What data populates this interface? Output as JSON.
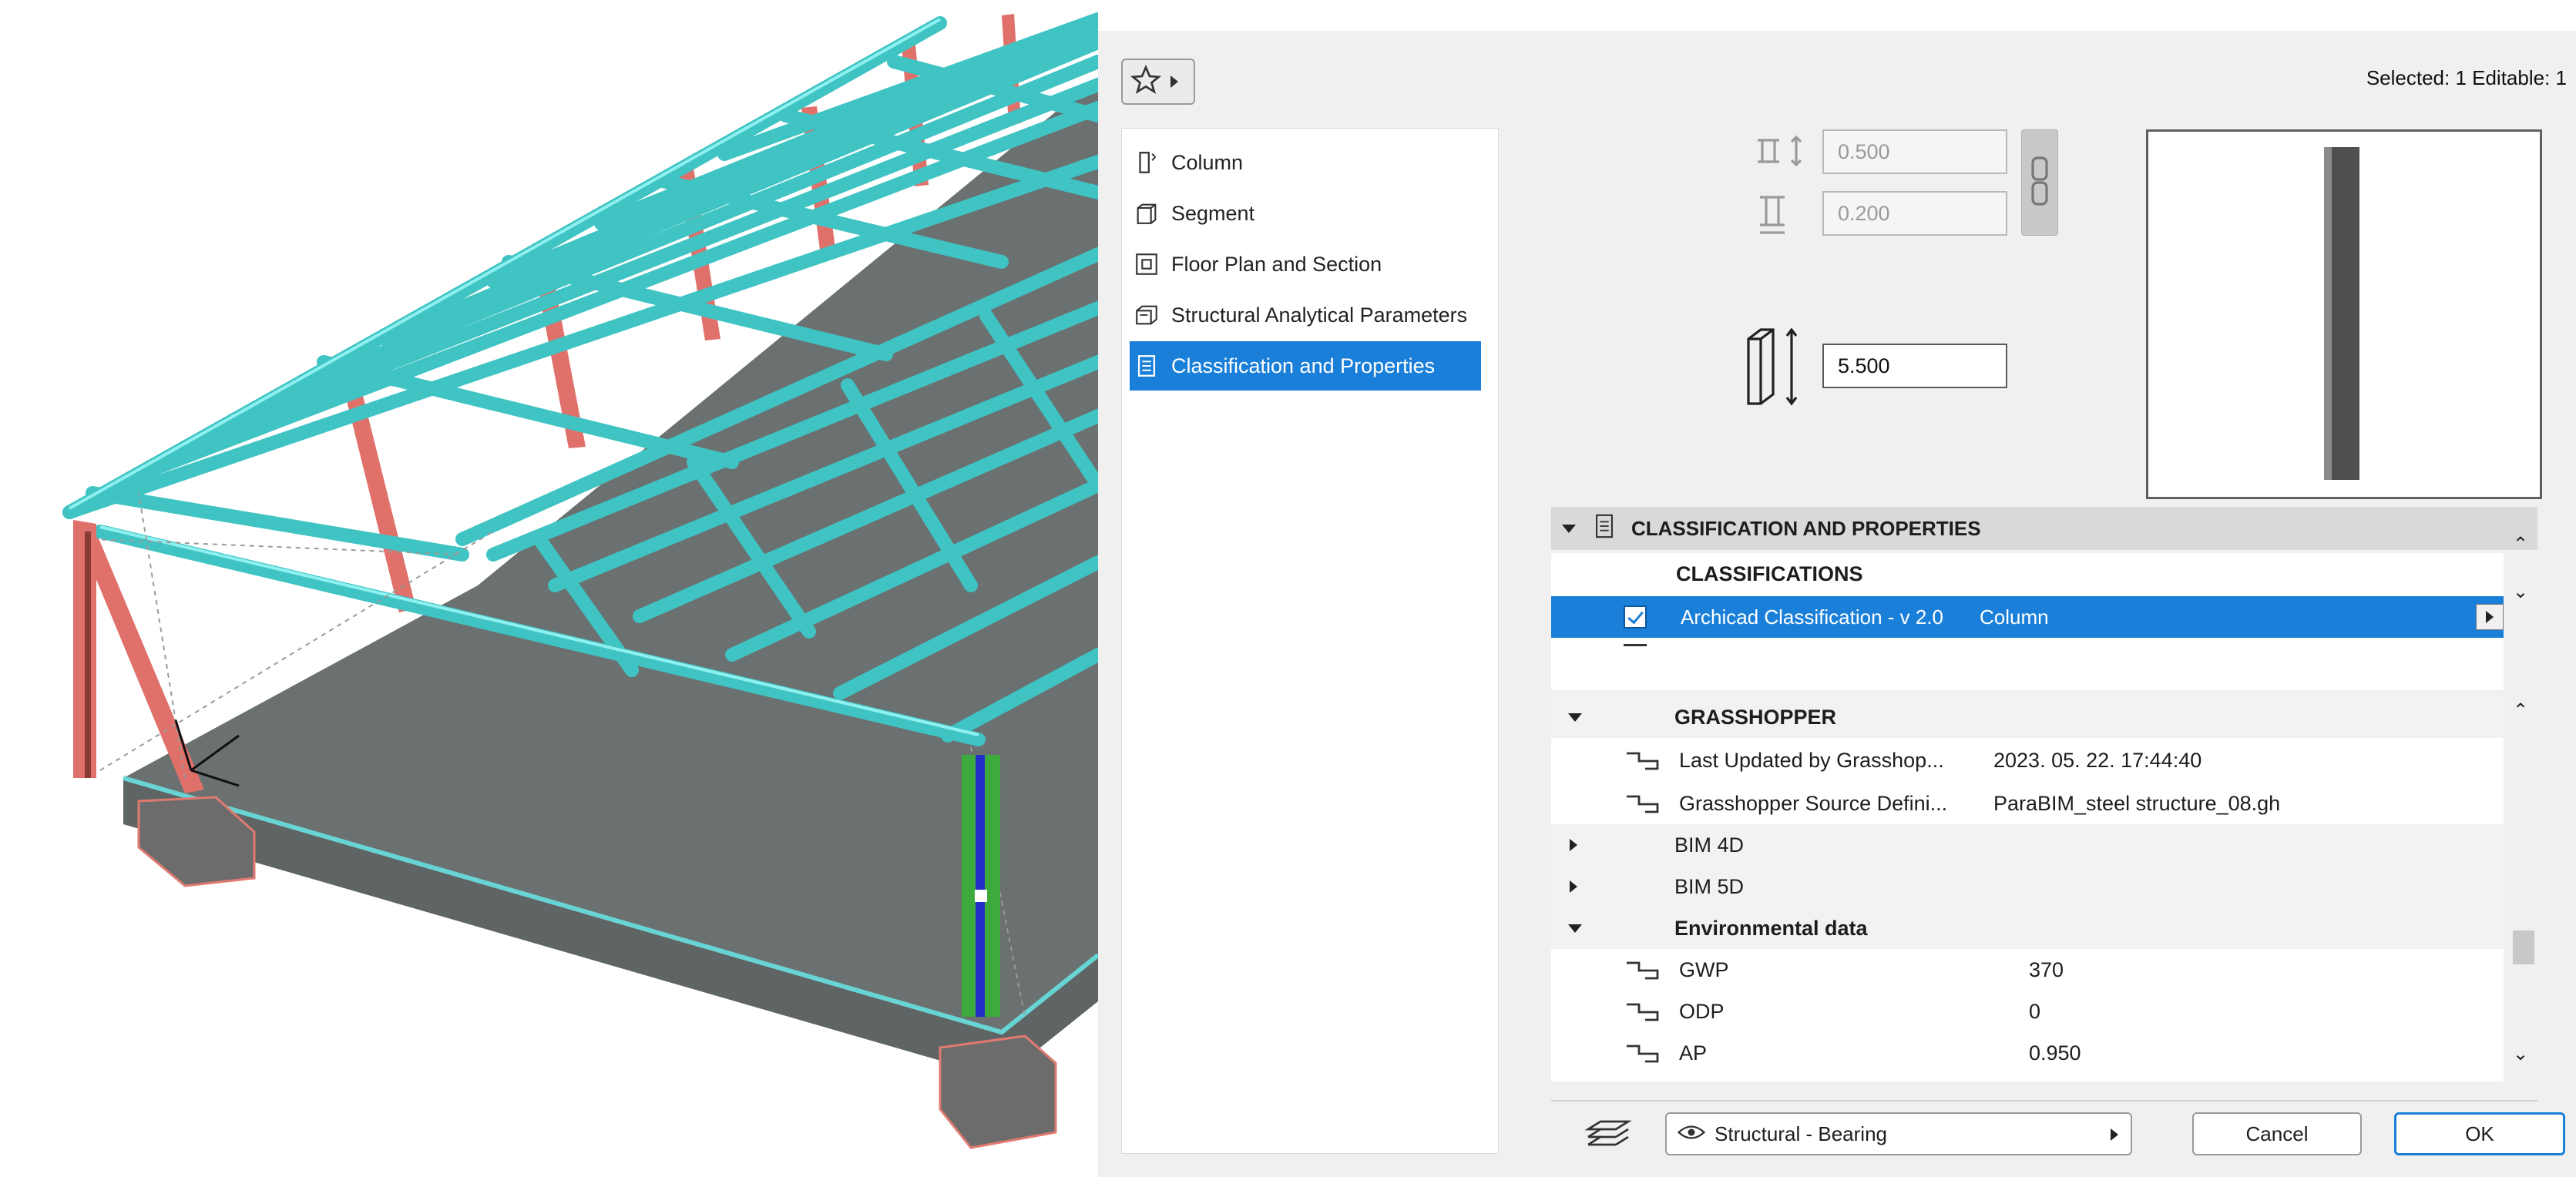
{
  "header": {
    "selection_info": "Selected: 1 Editable: 1"
  },
  "favorites": {
    "icon": "star-icon"
  },
  "nav": {
    "items": [
      {
        "label": "Column",
        "icon": "column-icon",
        "selected": false
      },
      {
        "label": "Segment",
        "icon": "segment-icon",
        "selected": false
      },
      {
        "label": "Floor Plan and Section",
        "icon": "floor-plan-icon",
        "selected": false
      },
      {
        "label": "Structural Analytical Parameters",
        "icon": "structural-analytical-icon",
        "selected": false
      },
      {
        "label": "Classification and Properties",
        "icon": "classification-icon",
        "selected": true
      }
    ]
  },
  "geometry": {
    "width_value": "0.500",
    "depth_value": "0.200",
    "height_value": "5.500"
  },
  "classification_section": {
    "title": "CLASSIFICATION AND PROPERTIES",
    "classifications_heading": "CLASSIFICATIONS",
    "system": "Archicad Classification - v 2.0",
    "class": "Column"
  },
  "properties": {
    "grasshopper": {
      "heading": "GRASSHOPPER",
      "rows": [
        {
          "name": "Last Updated by Grasshop...",
          "value": "2023. 05. 22. 17:44:40"
        },
        {
          "name": "Grasshopper Source Defini...",
          "value": "ParaBIM_steel structure_08.gh"
        }
      ]
    },
    "groups": [
      {
        "name": "BIM 4D"
      },
      {
        "name": "BIM 5D"
      },
      {
        "name": "Environmental data"
      }
    ],
    "environmental": [
      {
        "name": "GWP",
        "value": "370"
      },
      {
        "name": "ODP",
        "value": "0"
      },
      {
        "name": "AP",
        "value": "0.950"
      }
    ]
  },
  "footer": {
    "layer": "Structural - Bearing",
    "cancel_label": "Cancel",
    "ok_label": "OK"
  },
  "colors": {
    "selection_blue": "#1a7fd9",
    "beam_cyan": "#3fc3c3",
    "column_red": "#e0706a",
    "slab_grey": "#666b6b",
    "selected_column_green": "#3caa3c"
  }
}
